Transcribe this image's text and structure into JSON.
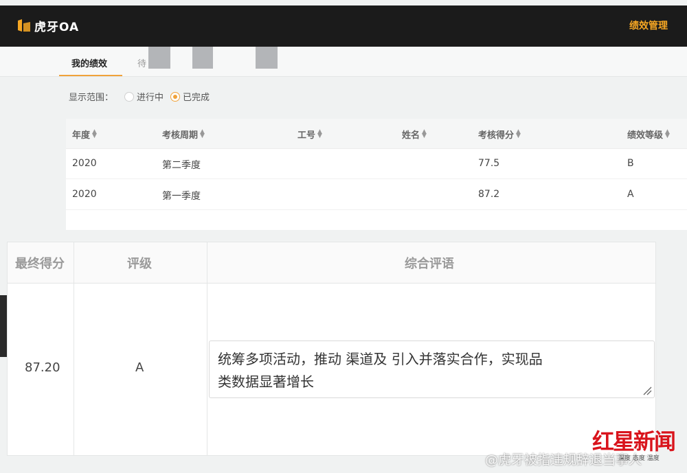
{
  "app": {
    "title": "虎牙OA",
    "top_menu": "绩效管理"
  },
  "tabs": [
    {
      "label": "我的绩效"
    },
    {
      "label": "待"
    }
  ],
  "filter": {
    "label": "显示范围：",
    "options": [
      {
        "label": "进行中",
        "checked": false
      },
      {
        "label": "已完成",
        "checked": true
      }
    ]
  },
  "perf_table": {
    "columns": [
      "年度",
      "考核周期",
      "工号",
      "姓名",
      "考核得分",
      "绩效等级"
    ],
    "rows": [
      {
        "year": "2020",
        "period": "第二季度",
        "id": "",
        "name": "",
        "score": "77.5",
        "grade": "B"
      },
      {
        "year": "2020",
        "period": "第一季度",
        "id": "",
        "name": "",
        "score": "87.2",
        "grade": "A"
      }
    ]
  },
  "review": {
    "headers": {
      "final_score": "最终得分",
      "rating": "评级",
      "comment": "综合评语"
    },
    "final_score": "87.20",
    "rating": "A",
    "comment_line1": "统筹多项活动，推动 渠道及 引入并落实合作，实现品",
    "comment_line2": "类数据显著增长"
  },
  "overlay": {
    "watermark": "@虎牙被指违规辞退当事人",
    "brand": "红星新闻",
    "brand_sub": "深度 态度 温度"
  },
  "colors": {
    "accent": "#f0a23a",
    "topbar": "#1b1b1b",
    "brand_red": "#d9141c"
  }
}
